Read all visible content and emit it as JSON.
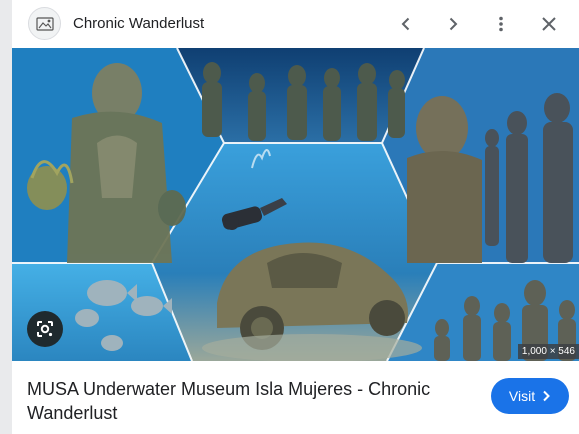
{
  "header": {
    "site_name": "Chronic Wanderlust",
    "logo_icon": "site-logo-icon",
    "prev_icon": "chevron-left-icon",
    "next_icon": "chevron-right-icon",
    "more_icon": "more-vert-icon",
    "close_icon": "close-icon"
  },
  "image": {
    "dimensions": "1,000 × 546",
    "lens_icon": "google-lens-icon"
  },
  "result": {
    "title": "MUSA Underwater Museum Isla Mujeres - Chronic Wanderlust",
    "visit_label": "Visit"
  },
  "colors": {
    "accent": "#1a73e8",
    "water_deep": "#15558f",
    "water_light": "#3f9fd8"
  }
}
